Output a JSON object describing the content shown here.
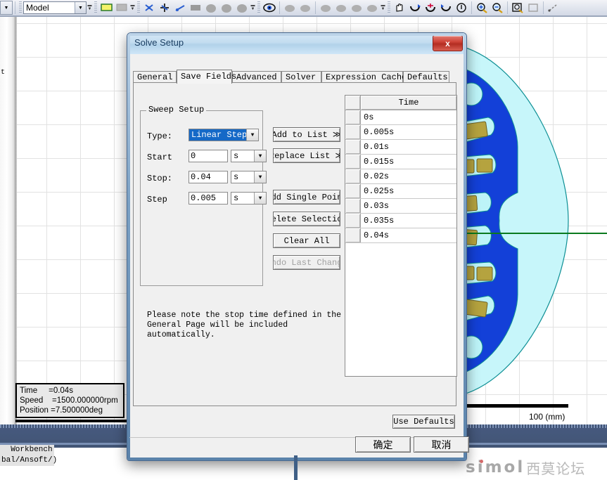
{
  "app": {
    "toolbar": {
      "model_combo_value": "Model",
      "icons": [
        "dropdown-arrow-icon",
        "model-combo",
        "expand-arrow-icon",
        "grip-handle",
        "plane-icon",
        "sheet-icon",
        "spinner-icon",
        "grip-handle",
        "move-xyz-icon",
        "move-free-icon",
        "rotate-icon",
        "face-select-icon",
        "object-select-icon",
        "edge-select-icon",
        "vertex-select-icon",
        "spinner-icon",
        "grip-handle",
        "eye-icon",
        "view-hide-icon",
        "view-show-icon",
        "visibility-a-icon",
        "visibility-b-icon",
        "visibility-c-icon",
        "visibility-d-icon",
        "spinner-icon",
        "grip-handle",
        "pan-hand-icon",
        "rotate-view-icon",
        "rotate-axis-icon",
        "rotate-z-icon",
        "dynamic-rotate-icon",
        "zoom-in-icon",
        "zoom-out-icon",
        "fit-all-icon",
        "fit-selection-icon",
        "measure-icon"
      ]
    },
    "viewport": {
      "left_edge_text": "t",
      "scale_label": "100 (mm)",
      "model_name": "motor-cross-section-model",
      "colors": {
        "rotor": "#1340d8",
        "air": "#bdf4f8",
        "magnet": "#b5a33f",
        "outline": "#0d8f94",
        "axis_line": "#0a7a1e",
        "grid": "#e2e2e2"
      }
    },
    "info_overlay": {
      "lines": [
        "Time     =0.04s",
        "Speed    =1500.000000rpm",
        "Position =7.500000deg"
      ]
    },
    "status": {
      "workbench_label": "  Workbench\nbal/Ansoft/)"
    },
    "watermark": {
      "brand": "simol",
      "brand_cn": "西莫论坛"
    }
  },
  "dialog": {
    "title": "Solve Setup",
    "close_label": "x",
    "tabs": [
      {
        "label": "General",
        "active": false
      },
      {
        "label": "Save Fields",
        "active": true
      },
      {
        "label": "Advanced",
        "active": false
      },
      {
        "label": "Solver",
        "active": false
      },
      {
        "label": "Expression Cache",
        "active": false
      },
      {
        "label": "Defaults",
        "active": false
      }
    ],
    "sweep_setup": {
      "group_label": "Sweep Setup",
      "type_label": "Type:",
      "type_value": "Linear Step",
      "start_label": "Start",
      "start_value": "0",
      "start_unit": "s",
      "stop_label": "Stop:",
      "stop_value": "0.04",
      "stop_unit": "s",
      "step_label": "Step",
      "step_value": "0.005",
      "step_unit": "s"
    },
    "actions": {
      "add_to_list": "Add to List ≫",
      "replace_list": "Replace List ≫",
      "add_single_point": "Add Single Point",
      "delete_selection": "Delete Selection",
      "clear_all": "Clear All",
      "undo_last_change": "Undo Last Change"
    },
    "note": "Please note the stop time defined in the\nGeneral Page will be included automatically.",
    "table": {
      "header_time": "Time",
      "rows": [
        "0s",
        "0.005s",
        "0.01s",
        "0.015s",
        "0.02s",
        "0.025s",
        "0.03s",
        "0.035s",
        "0.04s"
      ]
    },
    "use_defaults": "Use Defaults",
    "ok": "确定",
    "cancel": "取消"
  }
}
